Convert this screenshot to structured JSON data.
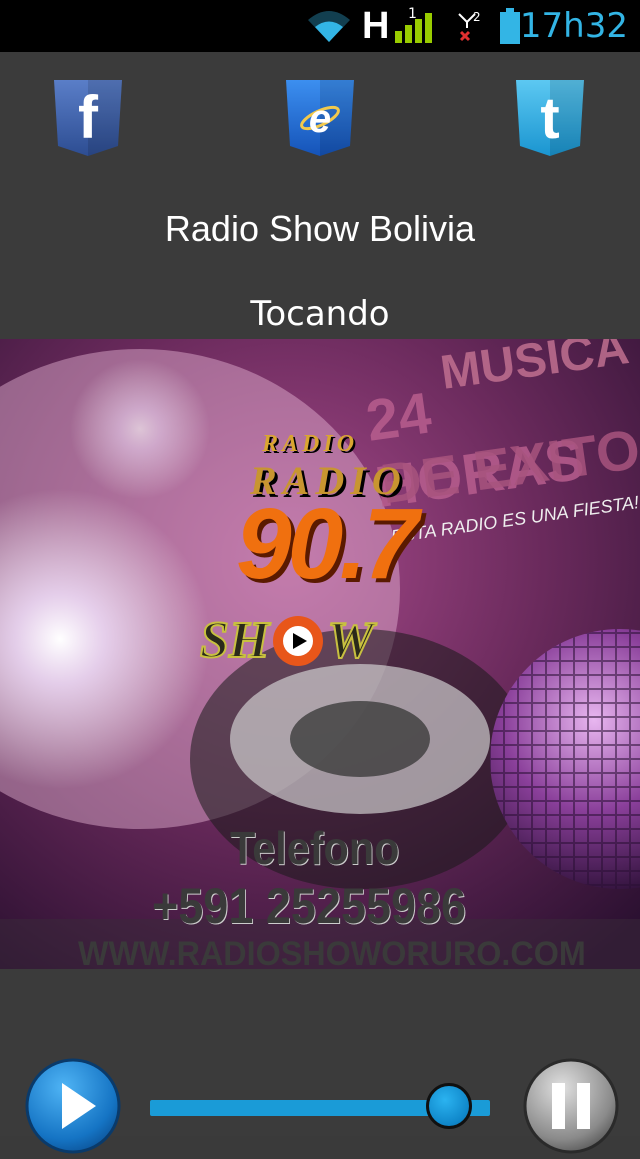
{
  "status_bar": {
    "time": "17h32",
    "network_type": "H",
    "sim1_label": "1",
    "sim2_label": "2",
    "icons": [
      "wifi-icon",
      "signal-h-icon",
      "sim2-no-signal-icon",
      "battery-icon"
    ]
  },
  "social": {
    "facebook": {
      "icon": "facebook-icon",
      "letter": "f",
      "color": "#3b5998"
    },
    "web": {
      "icon": "internet-explorer-icon",
      "letter": "e",
      "color": "#1e6fd0"
    },
    "twitter": {
      "icon": "twitter-icon",
      "letter": "t",
      "color": "#29a9e1"
    }
  },
  "station": {
    "title": "Radio Show Bolivia",
    "status": "Tocando"
  },
  "cover": {
    "logo_small": "RADIO",
    "logo_big": "RADIO",
    "frequency": "90.7",
    "show_word": "SH",
    "show_word_end": "W",
    "banner_line1": "MUSICA",
    "banner_line2": "24 HORAS",
    "banner_line3": "DE EXITOS",
    "slogan": "ESTA RADIO ES UNA FIESTA!!",
    "phone_label": "Telefono",
    "phone_number": "+591 25255986",
    "website": "WWW.RADIOSHOWORURO.COM"
  },
  "player": {
    "volume": 0.88,
    "play_icon": "play-icon",
    "pause_icon": "pause-icon",
    "accent": "#1a9bd7"
  }
}
